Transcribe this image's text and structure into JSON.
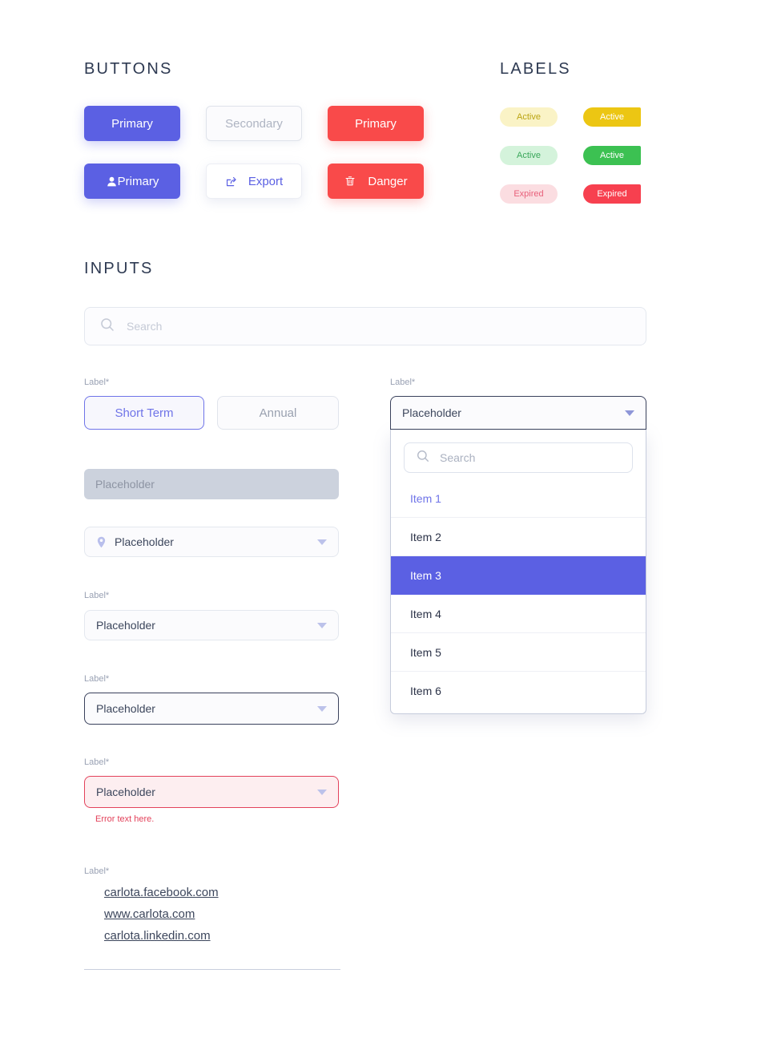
{
  "sections": {
    "buttons_title": "BUTTONS",
    "labels_title": "LABELS",
    "inputs_title": "INPUTS"
  },
  "buttons": [
    {
      "label": "Primary",
      "variant": "primary",
      "icon": null
    },
    {
      "label": "Secondary",
      "variant": "secondary",
      "icon": null
    },
    {
      "label": "Primary",
      "variant": "danger",
      "icon": null
    },
    {
      "label": "Primary",
      "variant": "primary",
      "icon": "person-icon"
    },
    {
      "label": "Export",
      "variant": "white",
      "icon": "share-export-icon"
    },
    {
      "label": "Danger",
      "variant": "danger",
      "icon": "trash-icon"
    }
  ],
  "labels": [
    {
      "text": "Active",
      "style": "soft-yellow",
      "bg": "#faf3c6",
      "fg": "#bba513"
    },
    {
      "text": "Active",
      "style": "solid-yellow",
      "bg": "#ecc613",
      "fg": "#ffffff"
    },
    {
      "text": "Active",
      "style": "soft-green",
      "bg": "#d4f3db",
      "fg": "#3aa75a"
    },
    {
      "text": "Active",
      "style": "solid-green",
      "bg": "#3cc152",
      "fg": "#ffffff"
    },
    {
      "text": "Expired",
      "style": "soft-red",
      "bg": "#fbdde1",
      "fg": "#e8607a"
    },
    {
      "text": "Expired",
      "style": "solid-red",
      "bg": "#f7404f",
      "fg": "#ffffff"
    }
  ],
  "inputs": {
    "search_placeholder": "Search",
    "segmented": {
      "label": "Label*",
      "active": "Short Term",
      "inactive": "Annual"
    },
    "disabled_field": {
      "value": "Placeholder"
    },
    "select_with_pin": {
      "value": "Placeholder",
      "icon": "location-pin-icon"
    },
    "select_plain": {
      "label": "Label*",
      "value": "Placeholder"
    },
    "select_focused": {
      "label": "Label*",
      "value": "Placeholder"
    },
    "select_error": {
      "label": "Label*",
      "value": "Placeholder",
      "error": "Error text here."
    },
    "links": {
      "label": "Label*",
      "items": [
        " carlota.facebook.com",
        "www.carlota.com",
        "carlota.linkedin.com"
      ]
    }
  },
  "dropdown": {
    "label": "Label*",
    "trigger_value": "Placeholder",
    "search_placeholder": "Search",
    "items": [
      {
        "text": "Item 1",
        "state": "link"
      },
      {
        "text": "Item 2",
        "state": "normal"
      },
      {
        "text": "Item 3",
        "state": "selected"
      },
      {
        "text": "Item 4",
        "state": "normal"
      },
      {
        "text": "Item 5",
        "state": "normal"
      },
      {
        "text": "Item 6",
        "state": "normal"
      }
    ]
  },
  "colors": {
    "primary": "#5b60e3",
    "danger": "#f94a4a",
    "error": "#e3425b",
    "text": "#2e3a52",
    "muted": "#9aa2b4"
  }
}
